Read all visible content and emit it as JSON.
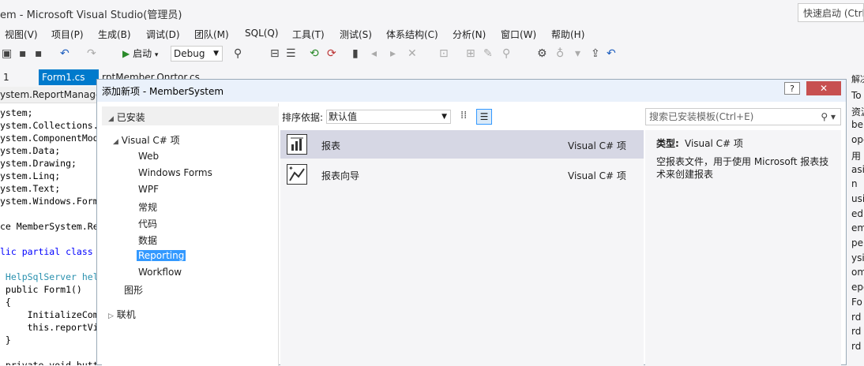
{
  "window": {
    "title": "em - Microsoft Visual Studio(管理员)",
    "quick_launch": "快速启动 (Ctrl"
  },
  "menu": [
    "视图(V)",
    "项目(P)",
    "生成(B)",
    "调试(D)",
    "团队(M)",
    "SQL(Q)",
    "工具(T)",
    "测试(S)",
    "体系结构(C)",
    "分析(N)",
    "窗口(W)",
    "帮助(H)"
  ],
  "toolbar": {
    "start_label": "启动",
    "config": "Debug"
  },
  "tabs": [
    {
      "label": "1"
    },
    {
      "label": "Form1.cs",
      "active": true
    },
    {
      "label": "rptMember.Onrtor.cs"
    }
  ],
  "right_panel": {
    "title": "解决方案资源管理",
    "lines": [
      "To",
      "资源",
      "ber",
      "ope",
      "用",
      "asic",
      "n",
      "usin",
      "edB",
      "em",
      "per",
      "ysic",
      "om",
      "epo",
      "Fo",
      "rd",
      "rd",
      "rd"
    ]
  },
  "editor": {
    "header": "ystem.ReportManage.F",
    "lines": [
      {
        "text": "ystem;",
        "cls": ""
      },
      {
        "text": "ystem.Collections.",
        "cls": ""
      },
      {
        "text": "ystem.ComponentMod",
        "cls": ""
      },
      {
        "text": "ystem.Data;",
        "cls": ""
      },
      {
        "text": "ystem.Drawing;",
        "cls": ""
      },
      {
        "text": "ystem.Linq;",
        "cls": ""
      },
      {
        "text": "ystem.Text;",
        "cls": ""
      },
      {
        "text": "ystem.Windows.Form",
        "cls": ""
      },
      {
        "text": "",
        "cls": ""
      },
      {
        "text": "ce MemberSystem.Re",
        "cls": ""
      },
      {
        "text": "",
        "cls": ""
      },
      {
        "text": "lic partial class",
        "cls": "kw"
      },
      {
        "text": "",
        "cls": ""
      },
      {
        "text": " HelpSqlServer hel",
        "cls": "ty"
      },
      {
        "text": " public Form1()",
        "cls": ""
      },
      {
        "text": " {",
        "cls": ""
      },
      {
        "text": "     InitializeCom",
        "cls": ""
      },
      {
        "text": "     this.reportVi",
        "cls": ""
      },
      {
        "text": " }",
        "cls": ""
      },
      {
        "text": "",
        "cls": ""
      },
      {
        "text": " private void butt",
        "cls": ""
      }
    ]
  },
  "dialog": {
    "title": "添加新项 - MemberSystem",
    "help": "?",
    "close": "✕",
    "tree": {
      "installed": "已安装",
      "vcs": "Visual C# 项",
      "children": [
        "Web",
        "Windows Forms",
        "WPF",
        "常规",
        "代码",
        "数据",
        "Reporting",
        "Workflow"
      ],
      "selected": "Reporting",
      "graphics": "图形",
      "online": "联机"
    },
    "sort_label": "排序依据:",
    "sort_value": "默认值",
    "items": [
      {
        "name": "报表",
        "type": "Visual C# 项",
        "selected": true
      },
      {
        "name": "报表向导",
        "type": "Visual C# 项",
        "selected": false
      }
    ],
    "search_placeholder": "搜索已安装模板(Ctrl+E)",
    "details": {
      "type_label": "类型:",
      "type_value": "Visual C# 项",
      "description": "空报表文件，用于使用 Microsoft 报表技术来创建报表"
    }
  }
}
